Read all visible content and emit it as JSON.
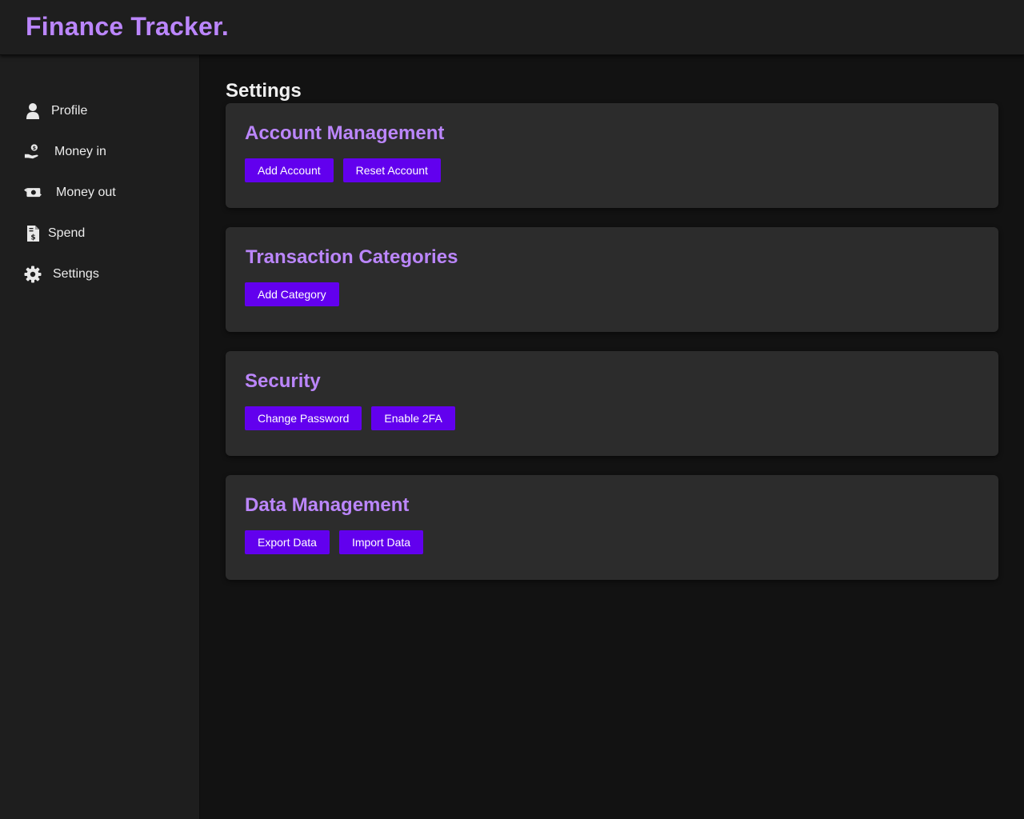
{
  "app": {
    "title": "Finance Tracker."
  },
  "sidebar": {
    "items": [
      {
        "label": "Profile",
        "icon": "user-icon"
      },
      {
        "label": "Money in",
        "icon": "hand-coin-icon"
      },
      {
        "label": "Money out",
        "icon": "money-transfer-icon"
      },
      {
        "label": "Spend",
        "icon": "invoice-icon"
      },
      {
        "label": "Settings",
        "icon": "gear-icon"
      }
    ]
  },
  "main": {
    "title": "Settings",
    "sections": [
      {
        "title": "Account Management",
        "buttons": [
          "Add Account",
          "Reset Account"
        ]
      },
      {
        "title": "Transaction Categories",
        "buttons": [
          "Add Category"
        ]
      },
      {
        "title": "Security",
        "buttons": [
          "Change Password",
          "Enable 2FA"
        ]
      },
      {
        "title": "Data Management",
        "buttons": [
          "Export Data",
          "Import Data"
        ]
      }
    ]
  },
  "colors": {
    "accent": "#bb86fc",
    "button": "#6200ee",
    "background": "#121212",
    "surface": "#1e1e1e",
    "card": "#2c2c2c"
  }
}
